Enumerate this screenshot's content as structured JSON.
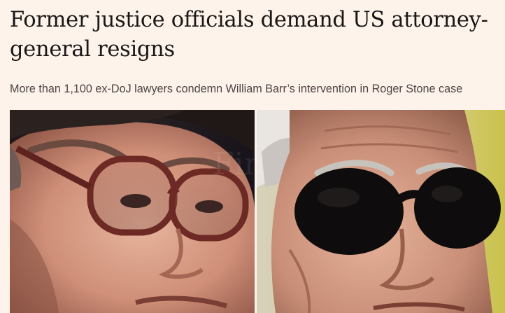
{
  "article": {
    "headline": "Former justice officials demand US attorney-general resigns",
    "standfirst": "More than 1,100 ex-DoJ lawyers condemn William Barr’s intervention in Roger Stone case"
  },
  "photos": {
    "left_subject": "William Barr",
    "right_subject": "Roger Stone"
  },
  "colors": {
    "page_background": "#fdf3eb",
    "headline_text": "#1a1716",
    "standfirst_text": "#4b4442"
  }
}
